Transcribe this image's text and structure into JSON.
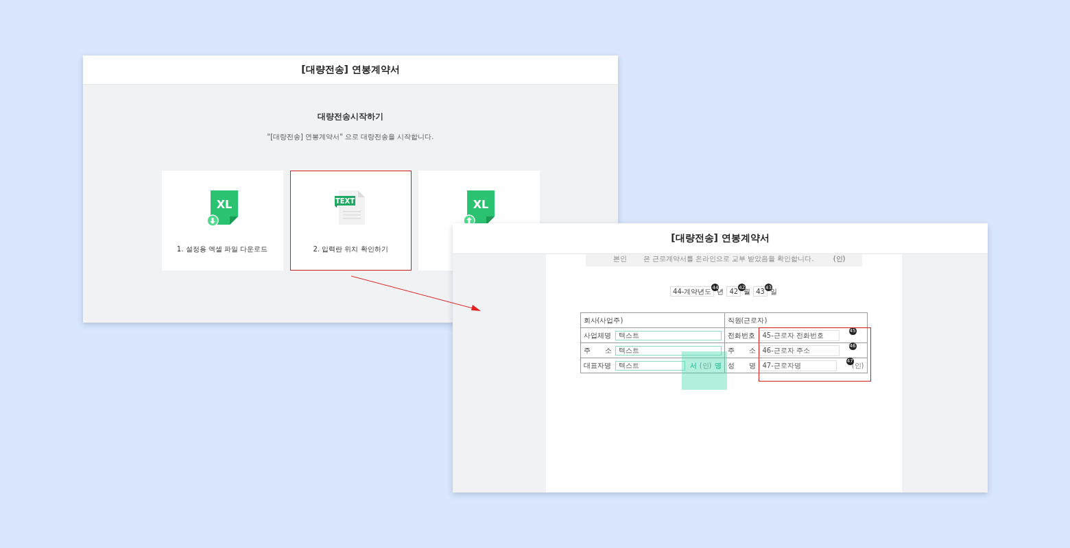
{
  "start_window": {
    "title": "[대량전송] 연봉계약서",
    "heading": "대량전송시작하기",
    "description": "\"[대량전송] 연봉계약서\" 으로 대량전송을 시작합니다.",
    "cards": [
      {
        "kind": "excel-download",
        "icon_text": "XL",
        "label": "1. 설정용 엑셀 파일 다운로드",
        "highlighted": false
      },
      {
        "kind": "text",
        "icon_text": "TEXT",
        "label": "2. 입력란 위치 확인하기",
        "highlighted": true
      },
      {
        "kind": "excel-upload",
        "icon_text": "XL",
        "highlighted": false
      }
    ]
  },
  "preview_window": {
    "title": "[대량전송] 연봉계약서",
    "notice": {
      "signer": "본인",
      "text": "은 근로계약서를 온라인으로 교부 받았음을 확인합니다.",
      "seal": "(인)"
    },
    "date_fields": [
      {
        "value": "44-계약년도",
        "badge": "44",
        "unit": "년"
      },
      {
        "value": "42",
        "badge": "42",
        "unit": "월"
      },
      {
        "value": "43",
        "badge": "43",
        "unit": "일"
      }
    ],
    "table": {
      "columns": [
        "회사(사업주)",
        "직원(근로자)"
      ],
      "rows": [
        {
          "company_label": "사업체명",
          "company_value": "텍스트",
          "employee_label": "전화번호",
          "employee_value": "45-근로자 전화번호",
          "badge": "45"
        },
        {
          "company_label": "주 소",
          "company_value": "텍스트",
          "employee_label": "주 소",
          "employee_value": "46-근로자 주소",
          "badge": "46"
        },
        {
          "company_label": "대표자명",
          "company_value": "텍스트",
          "company_seal": {
            "left": "서",
            "mark": "(인)",
            "right": "명"
          },
          "employee_label": "성 명",
          "employee_value": "47-근로자명",
          "badge": "47",
          "employee_suffix": "(인)"
        }
      ]
    },
    "highlight_box": true,
    "seal_overlay": true
  }
}
